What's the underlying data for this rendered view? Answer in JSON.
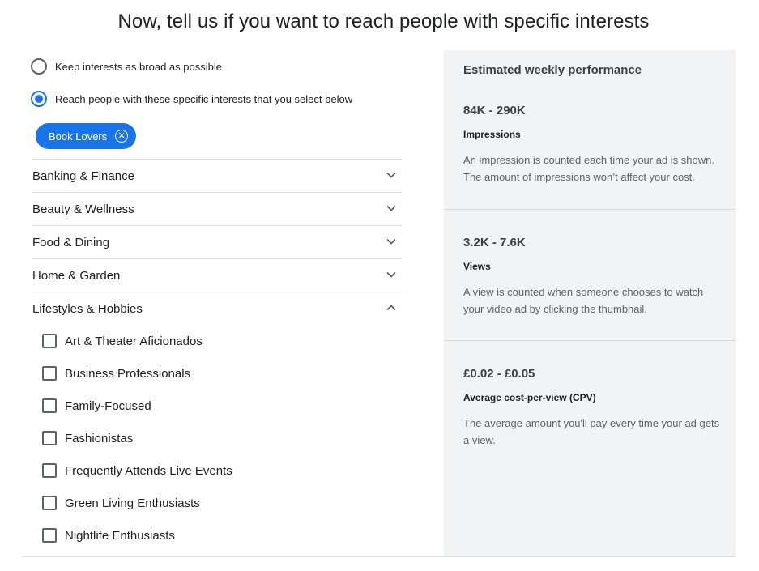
{
  "title": "Now, tell us if you want to reach people with specific interests",
  "options": {
    "broad": "Keep interests as broad as possible",
    "specific": "Reach people with these specific interests that you select below",
    "selected": "specific"
  },
  "chips": [
    {
      "label": "Book Lovers"
    }
  ],
  "categories": [
    {
      "label": "Banking & Finance",
      "expanded": false
    },
    {
      "label": "Beauty & Wellness",
      "expanded": false
    },
    {
      "label": "Food & Dining",
      "expanded": false
    },
    {
      "label": "Home & Garden",
      "expanded": false
    },
    {
      "label": "Lifestyles & Hobbies",
      "expanded": true
    }
  ],
  "subcategories": [
    {
      "label": "Art & Theater Aficionados",
      "checked": false
    },
    {
      "label": "Business Professionals",
      "checked": false
    },
    {
      "label": "Family-Focused",
      "checked": false
    },
    {
      "label": "Fashionistas",
      "checked": false
    },
    {
      "label": "Frequently Attends Live Events",
      "checked": false
    },
    {
      "label": "Green Living Enthusiasts",
      "checked": false
    },
    {
      "label": "Nightlife Enthusiasts",
      "checked": false
    }
  ],
  "performance": {
    "title": "Estimated weekly performance",
    "metrics": [
      {
        "value": "84K - 290K",
        "name": "Impressions",
        "description": "An impression is counted each time your ad is shown. The amount of impressions won’t affect your cost."
      },
      {
        "value": "3.2K - 7.6K",
        "name": "Views",
        "description": "A view is counted when someone chooses to watch your video ad by clicking the thumbnail."
      },
      {
        "value": "£0.02 - £0.05",
        "name": "Average cost-per-view (CPV)",
        "description": "The average amount you'll pay every time your ad gets a view."
      }
    ]
  },
  "colors": {
    "accent": "#1a73e8",
    "panel_bg": "#f1f3f4",
    "divider": "#dadce0"
  },
  "icons": {
    "chip_remove": "close-circle-icon",
    "collapsed": "chevron-down-icon",
    "expanded": "chevron-up-icon"
  }
}
